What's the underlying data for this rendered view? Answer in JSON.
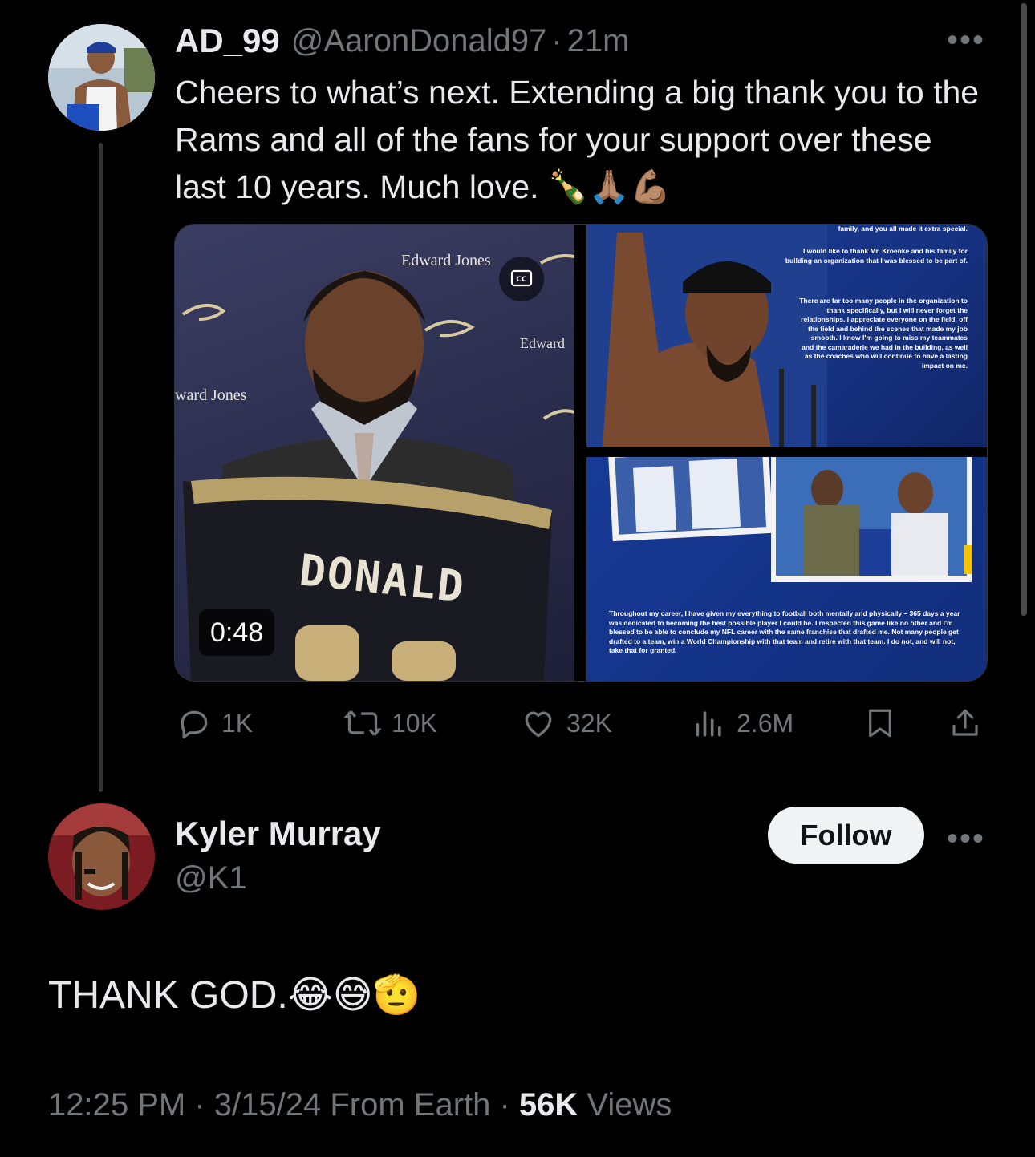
{
  "tweet": {
    "display_name": "AD_99",
    "handle": "@AaronDonald97",
    "separator": "·",
    "time_ago": "21m",
    "text": "Cheers to what’s next. Extending a big thank you to the Rams and all of the fans for your support over these last 10 years. Much love. 🍾🙏🏽💪🏽",
    "more_icon": "•••",
    "media": {
      "video_duration": "0:48",
      "captions_icon": "cc-icon",
      "video_texts": [
        "Edward Jones",
        "Edward",
        "ward Jones",
        "DONALD"
      ],
      "letter_top_line": "family, and you all made it extra special.",
      "letter_paragraph_1": "I would like to thank Mr. Kroenke and his family for building an organization that I was blessed to be part of.",
      "letter_paragraph_2": "There are far too many people in the organization to thank specifically, but I will never forget the relationships. I appreciate everyone on the field, off the field and behind the scenes that made my job smooth. I know I'm going to miss my teammates and the camaraderie we had in the building, as well as the coaches who will continue to have a lasting impact on me.",
      "letter_bottom": "Throughout my career, I have given my everything to football both mentally and physically – 365 days a year was dedicated to becoming the best possible player I could be. I respected this game like no other and I'm blessed to be able to conclude my NFL career with the same franchise that drafted me. Not many people get drafted to a team, win a World Championship with that team and retire with that team. I do not, and will not, take that for granted."
    },
    "actions": {
      "replies": "1K",
      "reposts": "10K",
      "likes": "32K",
      "views": "2.6M"
    }
  },
  "reply": {
    "display_name": "Kyler Murray",
    "handle": "@K1",
    "follow_label": "Follow",
    "more_icon": "•••",
    "text": "THANK GOD.😂😅🫡",
    "meta_time": "12:25 PM · 3/15/24 From Earth · ",
    "meta_views_count": "56K",
    "meta_views_label": " Views"
  },
  "colors": {
    "background": "#000000",
    "text": "#e7e9ea",
    "muted": "#71767b",
    "rams_blue": "#1b3d99"
  }
}
